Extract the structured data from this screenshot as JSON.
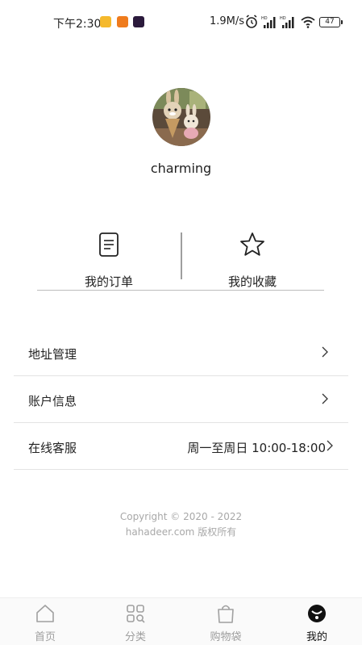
{
  "status_bar": {
    "time": "下午2:30",
    "network_speed": "1.9M/s",
    "battery": "47"
  },
  "profile": {
    "username": "charming"
  },
  "actions": {
    "orders_label": "我的订单",
    "favorites_label": "我的收藏"
  },
  "menu": {
    "address_label": "地址管理",
    "account_label": "账户信息",
    "service_label": "在线客服",
    "service_hours": "周一至周日 10:00-18:00"
  },
  "footer": {
    "copyright_line1": "Copyright © 2020 - 2022",
    "copyright_line2": "hahadeer.com 版权所有"
  },
  "tabbar": {
    "home": "首页",
    "category": "分类",
    "cart": "购物袋",
    "mine": "我的"
  }
}
